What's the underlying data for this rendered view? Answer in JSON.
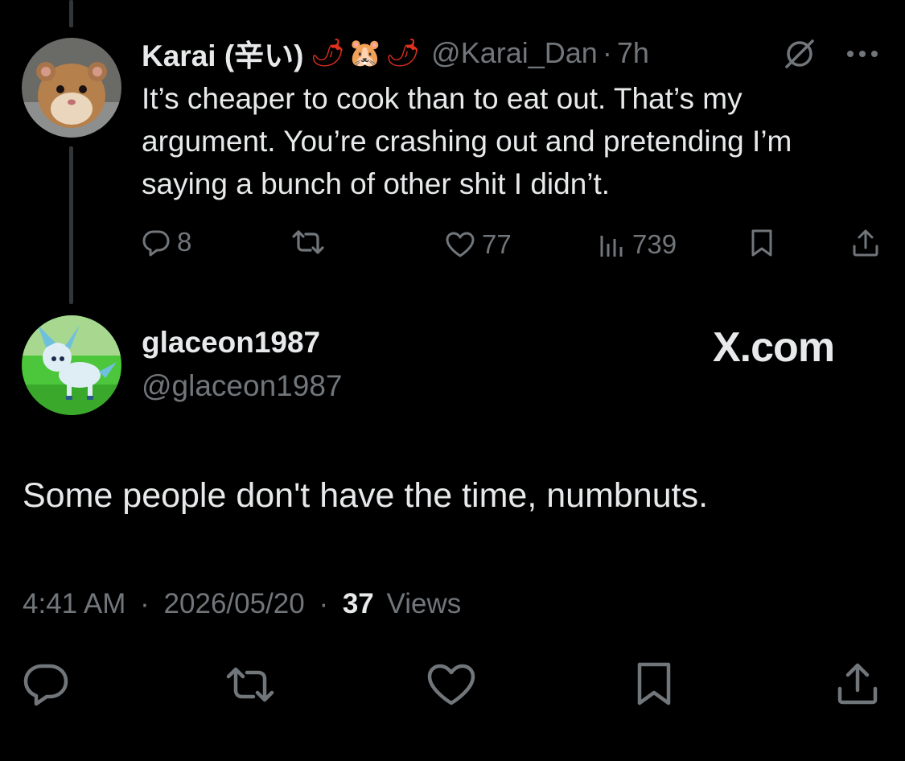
{
  "reply_parent": {
    "display_name": "Karai (辛い)",
    "emoji": [
      "chili-pepper",
      "hamster-face",
      "chili-pepper"
    ],
    "handle": "@Karai_Dan",
    "separator": "·",
    "age": "7h",
    "text": "It’s cheaper to cook than to eat out. That’s my argument. You’re crashing out and pretending I’m saying a bunch of other shit I didn’t.",
    "replies": "8",
    "likes": "77",
    "views": "739"
  },
  "main_tweet": {
    "display_name": "glaceon1987",
    "handle": "@glaceon1987",
    "watermark": "X.com",
    "text": "Some people don't have the time, numbnuts.",
    "time": "4:41 AM",
    "sep1": "·",
    "date": "2026/05/20",
    "sep2": "·",
    "views_count": "37",
    "views_label": "Views"
  },
  "colors": {
    "background": "#000000",
    "primary_text": "#e7e9ea",
    "secondary_text": "#71767b",
    "thread_line": "#333639"
  }
}
